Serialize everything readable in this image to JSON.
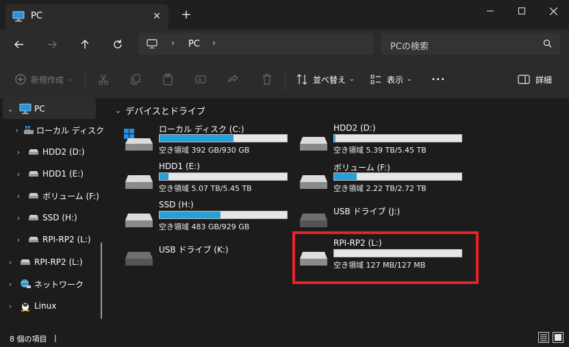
{
  "window": {
    "tab_label": "PC",
    "new_tab_symbol": "+",
    "tab_close_symbol": "✕",
    "minimize_symbol": "—",
    "maximize_symbol": "☐",
    "close_symbol": "✕"
  },
  "address": {
    "crumb": "PC",
    "search_placeholder": "PCの検索"
  },
  "commands": {
    "new_label": "新規作成",
    "sort_label": "並べ替え",
    "view_label": "表示",
    "more_label": "•••",
    "details_label": "詳細"
  },
  "sidebar": {
    "items": [
      {
        "label": "PC",
        "icon": "pc-icon"
      },
      {
        "label": "ローカル ディスク",
        "icon": "windows-drive-icon"
      },
      {
        "label": "HDD2 (D:)",
        "icon": "drive-icon"
      },
      {
        "label": "HDD1 (E:)",
        "icon": "drive-icon"
      },
      {
        "label": "ボリューム (F:)",
        "icon": "drive-icon"
      },
      {
        "label": "SSD (H:)",
        "icon": "drive-icon"
      },
      {
        "label": "RPI-RP2 (L:)",
        "icon": "drive-icon"
      },
      {
        "label": "RPI-RP2 (L:)",
        "icon": "drive-icon"
      },
      {
        "label": "ネットワーク",
        "icon": "network-icon"
      },
      {
        "label": "Linux",
        "icon": "linux-icon"
      }
    ]
  },
  "main": {
    "group_title": "デバイスとドライブ",
    "drives": [
      {
        "name": "ローカル ディスク (C:)",
        "free": "空き領域 392 GB/930 GB",
        "used_fraction": 0.58,
        "icon": "windows-drive-icon"
      },
      {
        "name": "HDD2 (D:)",
        "free": "空き領域 5.39 TB/5.45 TB",
        "used_fraction": 0.01,
        "icon": "drive-icon"
      },
      {
        "name": "HDD1 (E:)",
        "free": "空き領域 5.07 TB/5.45 TB",
        "used_fraction": 0.07,
        "icon": "drive-icon"
      },
      {
        "name": "ボリューム (F:)",
        "free": "空き領域 2.22 TB/2.72 TB",
        "used_fraction": 0.18,
        "icon": "drive-icon"
      },
      {
        "name": "SSD (H:)",
        "free": "空き領域 483 GB/929 GB",
        "used_fraction": 0.48,
        "icon": "drive-icon"
      },
      {
        "name": "USB ドライブ (J:)",
        "free": "",
        "used_fraction": null,
        "icon": "usb-drive-icon"
      },
      {
        "name": "USB ドライブ (K:)",
        "free": "",
        "used_fraction": null,
        "icon": "usb-drive-icon"
      },
      {
        "name": "RPI-RP2 (L:)",
        "free": "空き領域 127 MB/127 MB",
        "used_fraction": 0.0,
        "icon": "drive-icon"
      }
    ]
  },
  "status": {
    "item_count": "8 個の項目",
    "caret": "|"
  },
  "colors": {
    "accent": "#26a0da",
    "highlight": "#e8212b",
    "background": "#1c1c1c"
  }
}
